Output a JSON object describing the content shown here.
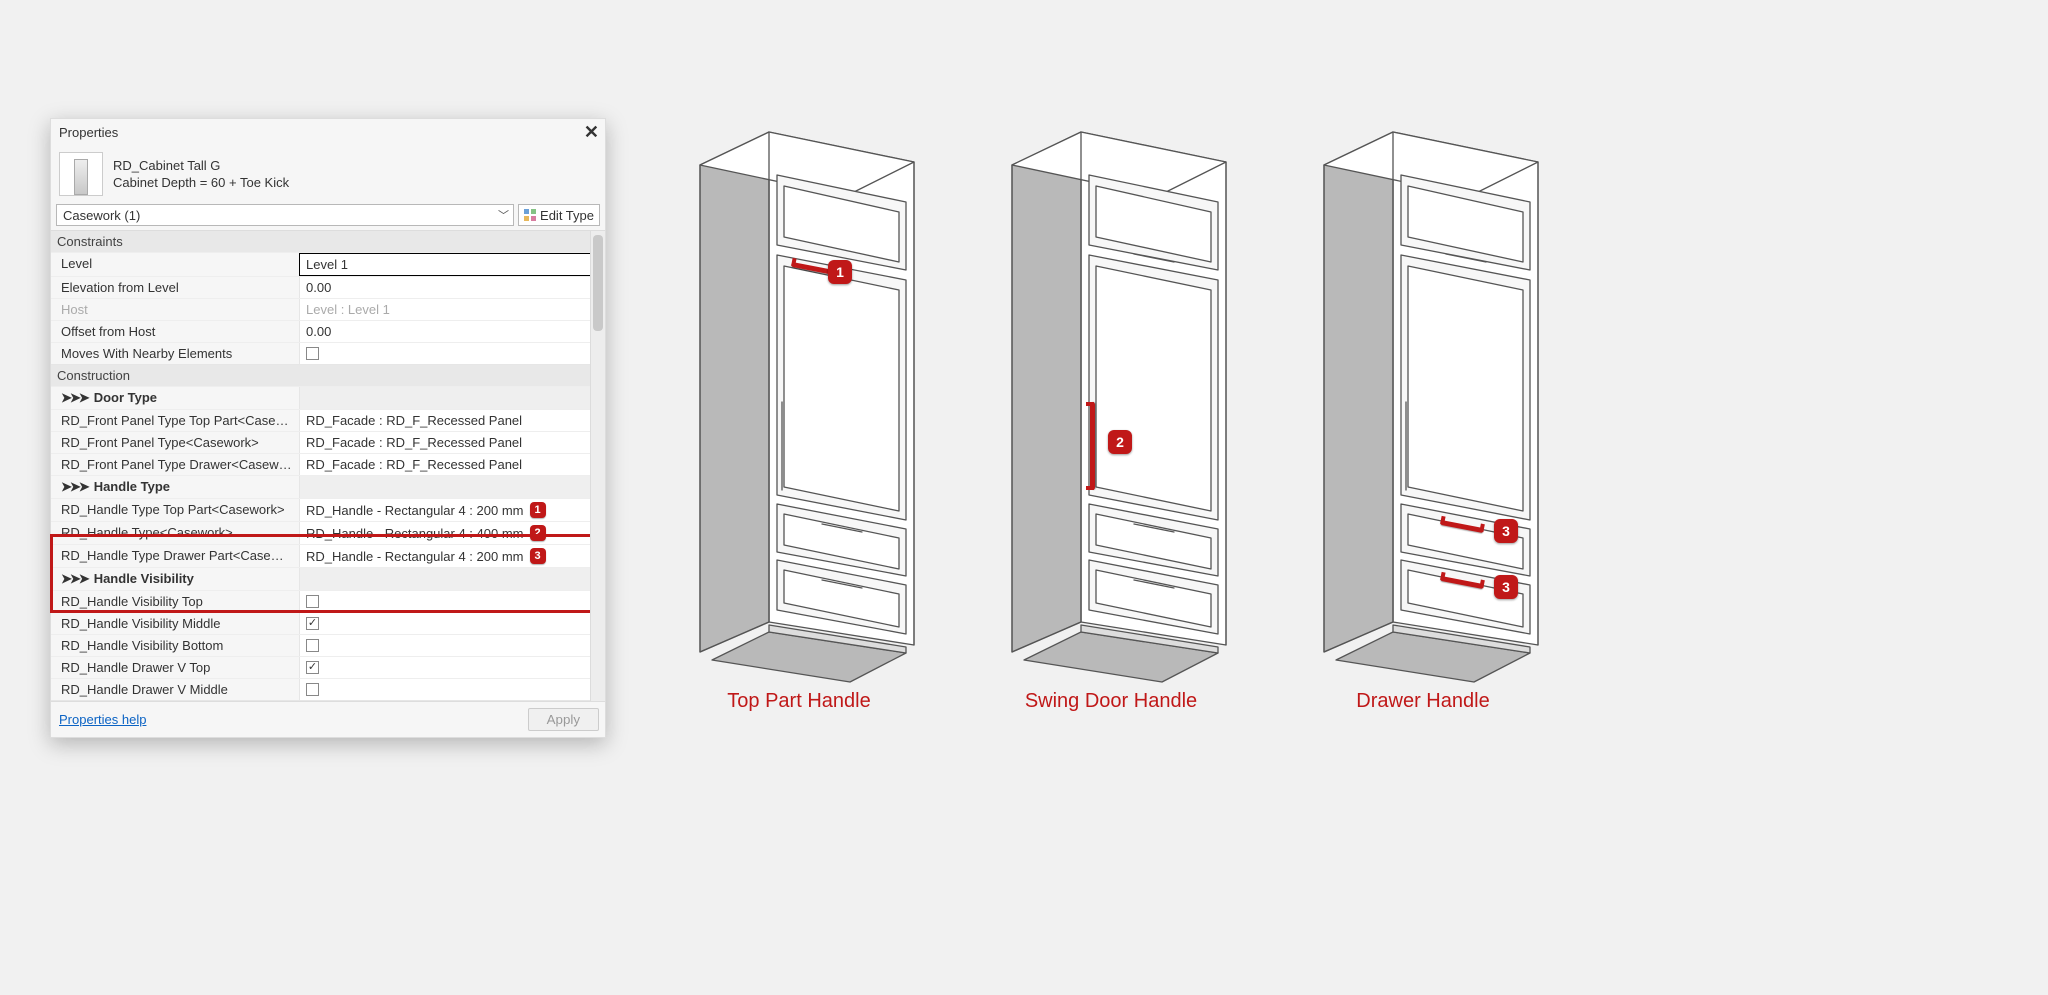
{
  "panel": {
    "title": "Properties",
    "family_name": "RD_Cabinet Tall G",
    "family_desc": "Cabinet Depth = 60 + Toe Kick",
    "selector": "Casework (1)",
    "edit_type": "Edit Type",
    "groups": {
      "constraints": {
        "title": "Constraints",
        "rows": {
          "level": {
            "label": "Level",
            "value": "Level 1"
          },
          "elev": {
            "label": "Elevation from Level",
            "value": "0.00"
          },
          "host": {
            "label": "Host",
            "value": "Level : Level 1"
          },
          "offset": {
            "label": "Offset from Host",
            "value": "0.00"
          },
          "moves": {
            "label": "Moves With Nearby Elements"
          }
        }
      },
      "construction": {
        "title": "Construction",
        "door_type": "Door Type",
        "fp_top": {
          "label": "RD_Front Panel Type Top Part<Casework>",
          "value": "RD_Facade : RD_F_Recessed Panel"
        },
        "fp_main": {
          "label": "RD_Front Panel Type<Casework>",
          "value": "RD_Facade : RD_F_Recessed Panel"
        },
        "fp_drawer": {
          "label": "RD_Front Panel Type Drawer<Casework>",
          "value": "RD_Facade : RD_F_Recessed Panel"
        },
        "handle_type": "Handle Type",
        "ht_top": {
          "label": "RD_Handle Type Top Part<Casework>",
          "value": "RD_Handle - Rectangular 4 : 200 mm",
          "badge": "1"
        },
        "ht_main": {
          "label": "RD_Handle Type<Casework>",
          "value": "RD_Handle - Rectangular 4 : 400 mm",
          "badge": "2"
        },
        "ht_drawer": {
          "label": "RD_Handle Type Drawer Part<Casework>",
          "value": "RD_Handle - Rectangular 4 : 200 mm",
          "badge": "3"
        },
        "handle_vis": "Handle Visibility",
        "hv_top": {
          "label": "RD_Handle Visibility Top"
        },
        "hv_mid": {
          "label": "RD_Handle Visibility Middle"
        },
        "hv_bot": {
          "label": "RD_Handle Visibility Bottom"
        },
        "hdv_top": {
          "label": "RD_Handle Drawer V Top"
        },
        "hdv_mid": {
          "label": "RD_Handle Drawer V Middle"
        }
      }
    },
    "footer": {
      "help": "Properties help",
      "apply": "Apply"
    }
  },
  "cabinets": {
    "label1": "Top Part Handle",
    "label2": "Swing Door Handle",
    "label3": "Drawer Handle",
    "badge1": "1",
    "badge2": "2",
    "badge3a": "3",
    "badge3b": "3"
  },
  "colors": {
    "accent_red": "#c01818"
  }
}
